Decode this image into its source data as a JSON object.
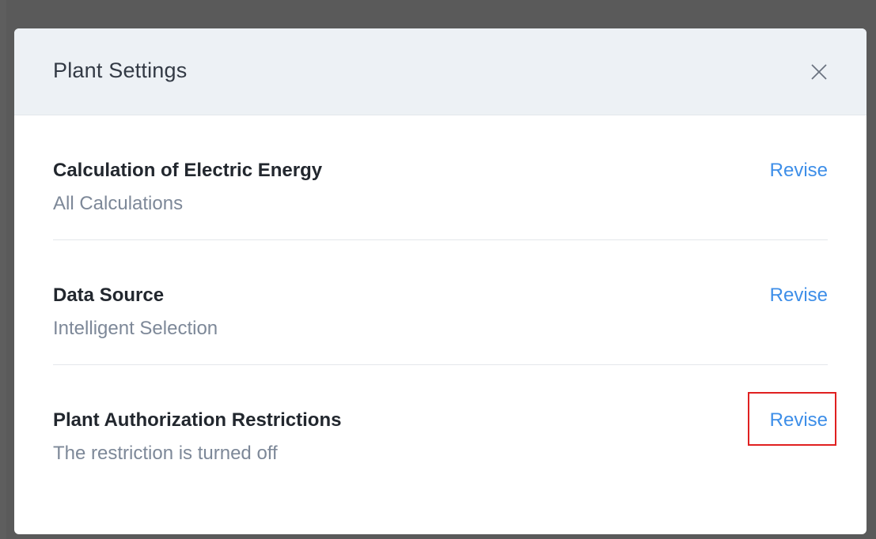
{
  "dialog": {
    "title": "Plant Settings",
    "close_icon": "close-icon"
  },
  "settings": [
    {
      "title": "Calculation of Electric Energy",
      "value": "All Calculations",
      "action_label": "Revise"
    },
    {
      "title": "Data Source",
      "value": "Intelligent Selection",
      "action_label": "Revise"
    },
    {
      "title": "Plant Authorization Restrictions",
      "value": "The restriction is turned off",
      "action_label": "Revise"
    }
  ],
  "colors": {
    "header_background": "#edf1f5",
    "link": "#3d8ee8",
    "highlight": "#e02020",
    "backdrop": "#5a5a5a"
  }
}
